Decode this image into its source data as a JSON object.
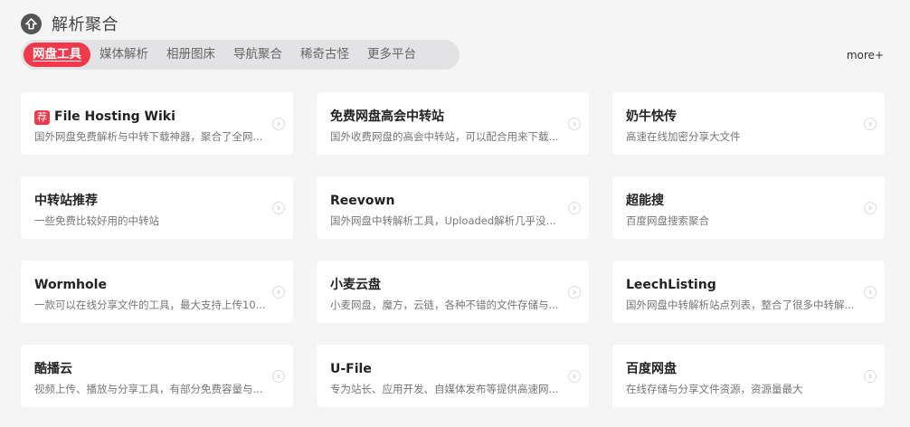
{
  "header": {
    "title": "解析聚合",
    "icon": "arrow-up-circle-icon"
  },
  "tabs": [
    {
      "label": "网盘工具",
      "active": true
    },
    {
      "label": "媒体解析",
      "active": false
    },
    {
      "label": "相册图床",
      "active": false
    },
    {
      "label": "导航聚合",
      "active": false
    },
    {
      "label": "稀奇古怪",
      "active": false
    },
    {
      "label": "更多平台",
      "active": false
    }
  ],
  "more_label": "more+",
  "colors": {
    "accent": "#f0394b",
    "background": "#f5f5f6"
  },
  "cards": [
    {
      "tag": "荐",
      "title": "File Hosting Wiki",
      "desc": "国外网盘免费解析与中转下载神器，聚合了全网..."
    },
    {
      "title": "免费网盘高会中转站",
      "desc": "国外收费网盘的高会中转站，可以配合用来下载..."
    },
    {
      "title": "奶牛快传",
      "desc": "高速在线加密分享大文件"
    },
    {
      "title": "中转站推荐",
      "desc": "一些免费比较好用的中转站"
    },
    {
      "title": "Reevown",
      "desc": "国外网盘中转解析工具，Uploaded解析几乎没..."
    },
    {
      "title": "超能搜",
      "desc": "百度网盘搜索聚合"
    },
    {
      "title": "Wormhole",
      "desc": "一款可以在线分享文件的工具，最大支持上传10..."
    },
    {
      "title": "小麦云盘",
      "desc": "小麦网盘，魔方，云链，各种不错的文件存储与..."
    },
    {
      "title": "LeechListing",
      "desc": "国外网盘中转解析站点列表，整合了很多中转解..."
    },
    {
      "title": "酷播云",
      "desc": "视频上传、播放与分享工具，有部分免费容量与..."
    },
    {
      "title": "U-File",
      "desc": "专为站长、应用开发、自媒体发布等提供高速网..."
    },
    {
      "title": "百度网盘",
      "desc": "在线存储与分享文件资源，资源量最大"
    }
  ]
}
